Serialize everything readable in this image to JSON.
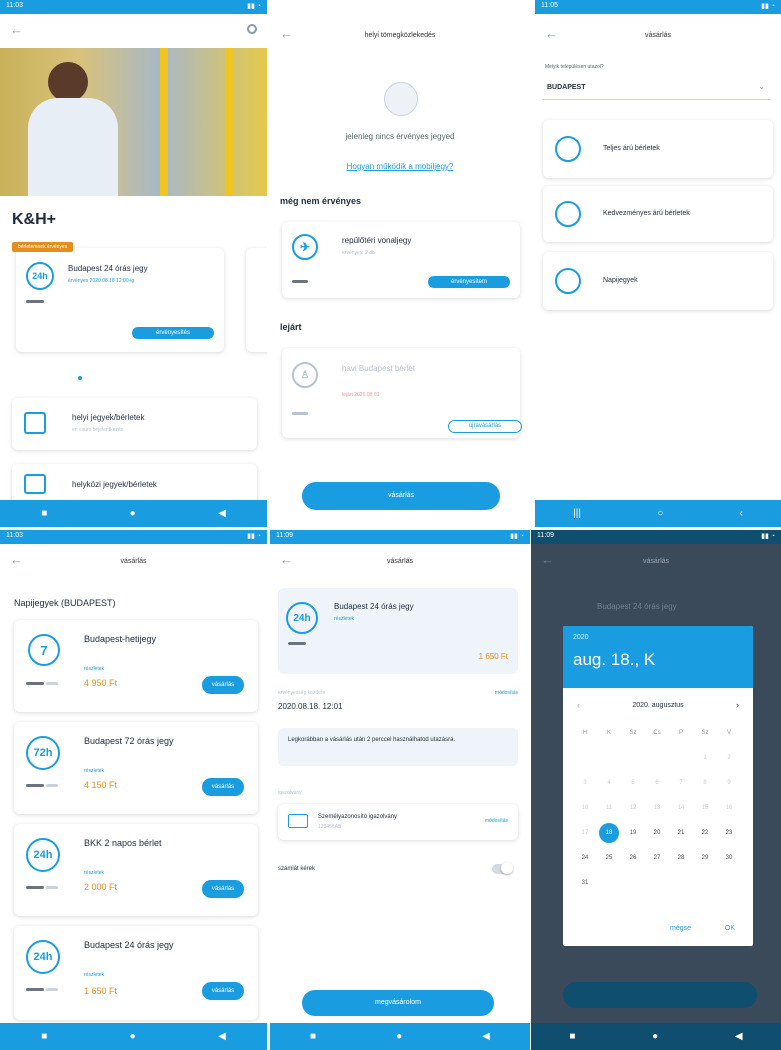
{
  "p1": {
    "brand": "K&H+",
    "badge_label": "bérletemnek érvényes",
    "ticket_name": "Budapest 24 órás jegy",
    "ticket_sub": "érvényes 2020.08.18 12:00-ig",
    "btn": "érvényesítés",
    "menu": [
      {
        "label": "helyi jegyek/bérletek",
        "sub": "en cours bejelentkezés"
      },
      {
        "label": "helyközi jegyek/bérletek",
        "sub": ""
      }
    ]
  },
  "p2": {
    "title": "helyi tömegközlekedés",
    "empty": "jelenleg nincs érvényes jegyed",
    "link": "Hogyan működik a mobiljegy?",
    "section1": "még nem érvényes",
    "ticket1": "repülőtéri vonaljegy",
    "ticket1_sub": "érvényes: 2 db",
    "btn1": "érvényesítem",
    "section2": "lejárt",
    "ticket2": "havi Budapest bérlet",
    "ticket2_sub": "lejárt 2020.08.03",
    "btn2": "újravásárlás",
    "buy": "vásárlás"
  },
  "p3": {
    "title": "vásárlás",
    "question": "Melyik településen utazol?",
    "city": "BUDAPEST",
    "options": [
      "Teljes árú bérletek",
      "Kedvezményes árú bérletek",
      "Napijegyek"
    ]
  },
  "p4": {
    "title": "vásárlás",
    "heading": "Napijegyek (BUDAPEST)",
    "items": [
      {
        "badge": "7",
        "name": "Budapest-hetijegy",
        "price": "4 950 Ft"
      },
      {
        "badge": "72h",
        "name": "Budapest 72 órás jegy",
        "price": "4 150 Ft"
      },
      {
        "badge": "24h",
        "name": "BKK 2 napos bérlet",
        "price": "2 000 Ft"
      },
      {
        "badge": "24h",
        "name": "Budapest 24 órás jegy",
        "price": "1 650 Ft"
      }
    ],
    "sub": "részletek",
    "btn": "vásárlás"
  },
  "p5": {
    "title": "vásárlás",
    "ticket": "Budapest 24 órás jegy",
    "sub": "részletek",
    "price": "1 650 Ft",
    "start_label": "érvényesség kezdete",
    "start_value": "2020.08.18. 12:01",
    "modify": "módosítás",
    "info": "Legkorábban a vásárlás után 2 perccel használhatod utazásra.",
    "id_label": "igazolvány",
    "id_value": "Személyazonosító igazolvány",
    "id_sub": "123456AB",
    "id_change": "módosítás",
    "invoice": "számlát kérek",
    "btn": "megvásárolom"
  },
  "p6": {
    "year": "2020",
    "date": "aug. 18., K",
    "month": "2020. augusztus",
    "days": [
      "H",
      "K",
      "Sz",
      "Cs",
      "P",
      "Sz",
      "V"
    ],
    "weeks": [
      [
        "",
        "",
        "",
        "",
        "",
        "1",
        "2"
      ],
      [
        "3",
        "4",
        "5",
        "6",
        "7",
        "8",
        "9"
      ],
      [
        "10",
        "11",
        "12",
        "13",
        "14",
        "15",
        "16"
      ],
      [
        "17",
        "18",
        "19",
        "20",
        "21",
        "22",
        "23"
      ],
      [
        "24",
        "25",
        "26",
        "27",
        "28",
        "29",
        "30"
      ],
      [
        "31",
        "",
        "",
        "",
        "",
        "",
        ""
      ]
    ],
    "cancel": "mégse",
    "ok": "OK",
    "bg_title": "vásárlás",
    "bg_ticket": "Budapest 24 órás jegy"
  }
}
